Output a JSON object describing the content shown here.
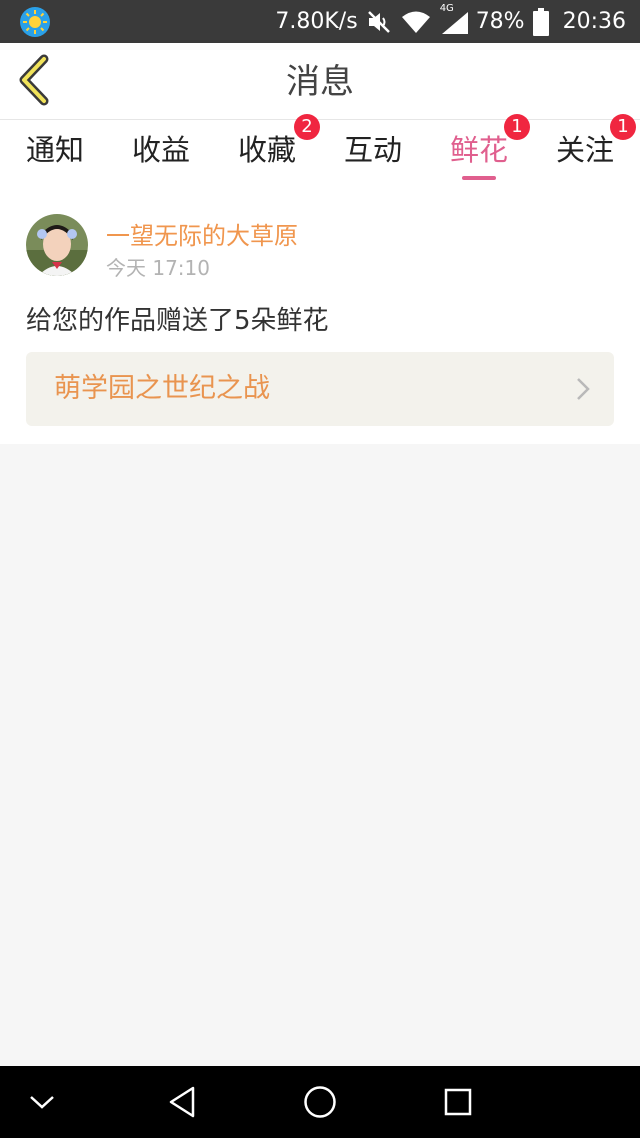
{
  "status_bar": {
    "network_speed": "7.80K/s",
    "signal_label": "4G",
    "battery": "78%",
    "time": "20:36"
  },
  "header": {
    "title": "消息"
  },
  "tabs": [
    {
      "label": "通知",
      "badge": ""
    },
    {
      "label": "收益",
      "badge": ""
    },
    {
      "label": "收藏",
      "badge": "2"
    },
    {
      "label": "互动",
      "badge": ""
    },
    {
      "label": "鲜花",
      "badge": "1"
    },
    {
      "label": "关注",
      "badge": "1"
    }
  ],
  "active_tab": "鲜花",
  "message": {
    "sender": "一望无际的大草原",
    "time": "今天 17:10",
    "text": "给您的作品赠送了5朵鲜花",
    "work_title": "萌学园之世纪之战"
  },
  "colors": {
    "accent_pink": "#e05f8e",
    "orange_text": "#f0964e",
    "badge_red": "#f02640",
    "status_bar_bg": "#3a3a3a"
  },
  "icons": {
    "app_icon": "sun-app-icon",
    "mute": "mute-icon",
    "wifi": "wifi-icon",
    "signal": "signal-icon",
    "battery": "battery-icon",
    "back": "back-chevron-icon",
    "nav_down": "chevron-down-icon",
    "nav_back": "triangle-back-icon",
    "nav_home": "circle-home-icon",
    "nav_recent": "square-recent-icon"
  }
}
